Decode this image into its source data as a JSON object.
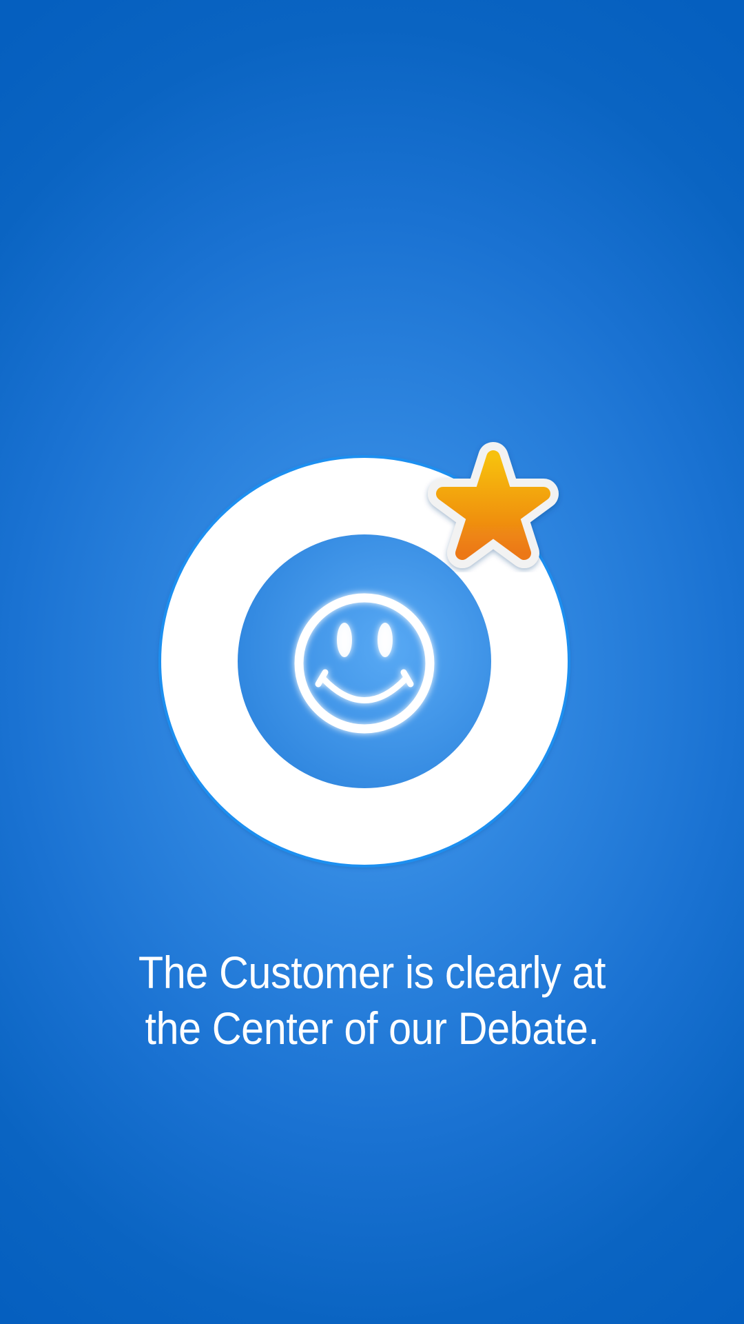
{
  "screen": {
    "caption": "The Customer is clearly at the Center of our Debate."
  },
  "graphic": {
    "icons": [
      "smiley-face-icon",
      "star-icon"
    ],
    "colors": {
      "background_center": "#4a9ff0",
      "background_edge": "#055fbf",
      "ring": "#ffffff",
      "ring_outline": "#1e8ff0",
      "inner_disc": "#3f93e6",
      "smiley": "#ffffff",
      "star_top": "#f7c00a",
      "star_bottom": "#ec7814",
      "star_border": "#f2f2f2",
      "caption_text": "#ffffff"
    }
  }
}
